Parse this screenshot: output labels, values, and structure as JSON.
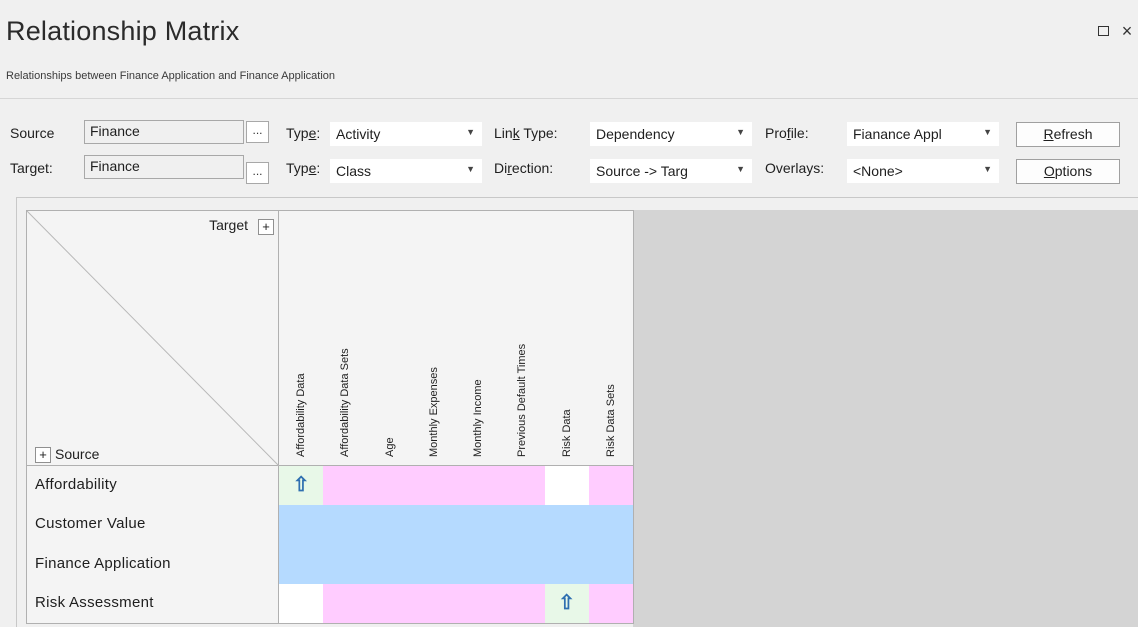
{
  "window": {
    "title": "Relationship Matrix",
    "subtitle": "Relationships between Finance Application and Finance Application",
    "maximize_icon": "maximize-icon",
    "close_glyph": "×"
  },
  "toolbar": {
    "source_label": "Source",
    "source_value": "Finance",
    "target_label": "Target:",
    "target_value": "Finance",
    "browse_label": "...",
    "type_label_pre": "Typ",
    "type_label_u": "e",
    "type_label_post": ":",
    "source_type": "Activity",
    "target_type": "Class",
    "link_type_pre": "Lin",
    "link_type_u": "k",
    "link_type_post": " Type:",
    "link_type_value": "Dependency",
    "direction_pre": "Di",
    "direction_u": "r",
    "direction_post": "ection:",
    "direction_value": "Source -> Targ",
    "profile_pre": "Pro",
    "profile_u": "f",
    "profile_post": "ile:",
    "profile_value": "Fianance Appl",
    "overlays_label": "Overlays:",
    "overlays_value": "<None>",
    "refresh_u": "R",
    "refresh_rest": "efresh",
    "options_u": "O",
    "options_rest": "ptions",
    "dropdown_arrow": "▼"
  },
  "matrix": {
    "target_label": "Target",
    "source_label": "Source",
    "plus": "+",
    "arrow_glyph": "⇧",
    "columns": [
      "Affordability Data",
      "Affordability Data Sets",
      "Age",
      "Monthly Expenses",
      "Monthly Income",
      "Previous Default Times",
      "Risk Data",
      "Risk Data Sets"
    ],
    "rows": [
      "Affordability",
      "Customer Value",
      "Finance Application",
      "Risk Assessment"
    ],
    "colors": {
      "relationship": "#e8f8e8",
      "pink": "#ffccff",
      "blue": "#b5daff",
      "empty": "#ffffff"
    },
    "cells": [
      [
        "rel",
        "pink",
        "pink",
        "pink",
        "pink",
        "pink",
        "empty",
        "pink"
      ],
      [
        "blue",
        "blue",
        "blue",
        "blue",
        "blue",
        "blue",
        "blue",
        "blue"
      ],
      [
        "blue",
        "blue",
        "blue",
        "blue",
        "blue",
        "blue",
        "blue",
        "blue"
      ],
      [
        "empty",
        "pink",
        "pink",
        "pink",
        "pink",
        "pink",
        "rel",
        "pink"
      ]
    ]
  }
}
